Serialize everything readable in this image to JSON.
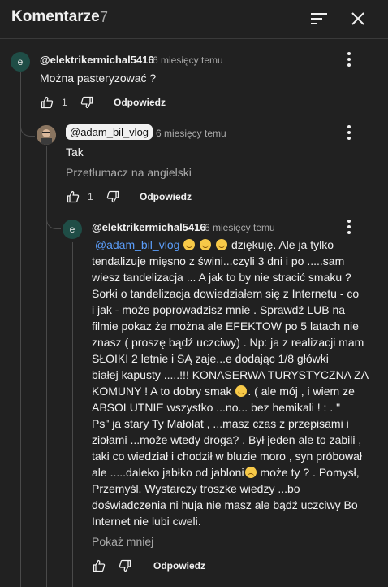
{
  "header": {
    "title": "Komentarze",
    "count": "7"
  },
  "comments": [
    {
      "author": "@elektrikermichal5416",
      "avatar_letter": "e",
      "time": "6 miesięcy temu",
      "text": "Można pasteryzować ?",
      "likes": "1",
      "reply_label": "Odpowiedz"
    },
    {
      "author": "@adam_bil_vlog",
      "time": "6 miesięcy temu",
      "text": "Tak",
      "translate_label": "Przetłumacz na angielski",
      "likes": "1",
      "reply_label": "Odpowiedz"
    },
    {
      "author": "@elektrikermichal5416",
      "avatar_letter": "e",
      "time": "6 miesięcy temu",
      "mention": "@adam_bil_vlog",
      "lines": [
        "  dziękuję.  Ale ja tylko",
        "tendalizuje mięsno z świni...czyli 3 dni i  po .....sam",
        "wiesz tandelizacja ...  A jak to by nie stracić smaku ?",
        "Sorki o tandelizacja dowiedziałem się z Internetu  - co",
        "i jak - może poprowadzisz mnie  . Sprawdź LUB  na",
        "filmie pokaz że można ale EFEKTOW  po 5 latach nie",
        "znasz ( proszę bądź uczciwy) . Np: ja z realizacji mam",
        "SŁOIKI 2 letnie  i SĄ  zaje...e  dodając 1/8  główki",
        "białej  kapusty  .....!!! KONASERWA TURYSTYCZNA  ZA",
        "KOMUNY !  A to dobry smak",
        ". ( ale mój  , i wiem ze",
        "ABSOLUTNIE  wszystko  ...no... bez hemikali ! : . \"",
        "Ps\" ja stary Ty Małolat  , ...masz czas z przepisami i",
        "ziołami  ...może wtedy droga? . Był jeden ale to zabili ,",
        "taki co wiedział i chodził w bluzie moro , syn próbował",
        "ale .....daleko jabłko od jabloni",
        "  może ty ? . Pomysł,",
        "Przemyśl. Wystarczy troszke wiedzy ...bo",
        "doświadczenia ni huja nie masz  ale bądź uczciwy Bo",
        "Internet nie lubi cweli."
      ],
      "show_less_label": "Pokaż mniej",
      "reply_label": "Odpowiedz"
    }
  ]
}
